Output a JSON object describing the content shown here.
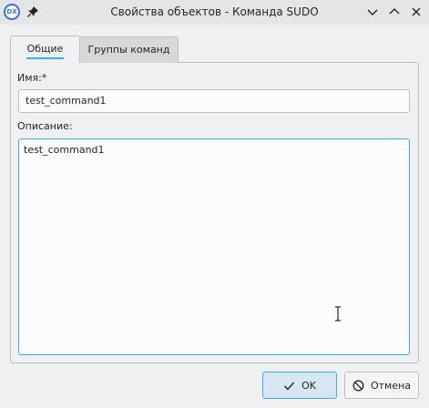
{
  "window": {
    "title": "Свойства объектов - Команда SUDO",
    "app_icon_text": "DX"
  },
  "tabs": [
    {
      "label": "Общие",
      "active": true
    },
    {
      "label": "Группы команд",
      "active": false
    }
  ],
  "form": {
    "name_label": "Имя:*",
    "name_value": "test_command1",
    "description_label": "Описание:",
    "description_value": "test_command1"
  },
  "buttons": {
    "ok_label": "OK",
    "cancel_label": "Отмена"
  },
  "colors": {
    "accent": "#3daee9",
    "window_bg": "#eff0f1",
    "titlebar_bg": "#e3e5e7"
  }
}
